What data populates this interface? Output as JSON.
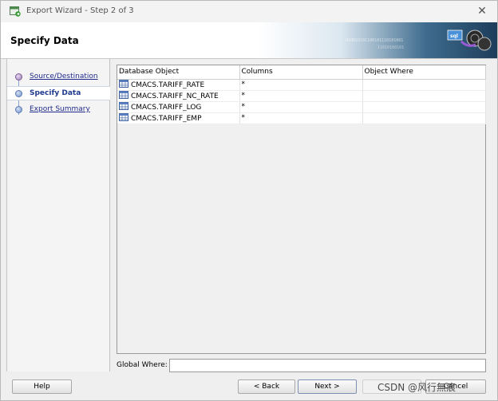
{
  "window": {
    "title": "Export Wizard - Step 2 of 3",
    "close_label": "✕"
  },
  "header": {
    "title": "Specify Data",
    "banner_text": "sql"
  },
  "steps": [
    {
      "label": "Source/Destination",
      "state": "visited"
    },
    {
      "label": "Specify Data",
      "state": "active"
    },
    {
      "label": "Export Summary",
      "state": "pending"
    }
  ],
  "grid": {
    "columns": [
      "Database Object",
      "Columns",
      "Object Where"
    ],
    "rows": [
      {
        "object": "CMACS.TARIFF_RATE",
        "columns": "*",
        "where": ""
      },
      {
        "object": "CMACS.TARIFF_NC_RATE",
        "columns": "*",
        "where": ""
      },
      {
        "object": "CMACS.TARIFF_LOG",
        "columns": "*",
        "where": ""
      },
      {
        "object": "CMACS.TARIFF_EMP",
        "columns": "*",
        "where": ""
      }
    ]
  },
  "global_where": {
    "label": "Global Where:",
    "value": ""
  },
  "buttons": {
    "help": "Help",
    "back": "< Back",
    "next": "Next >",
    "finish": "",
    "cancel": "Cancel"
  },
  "watermark": "CSDN @风行無痕"
}
